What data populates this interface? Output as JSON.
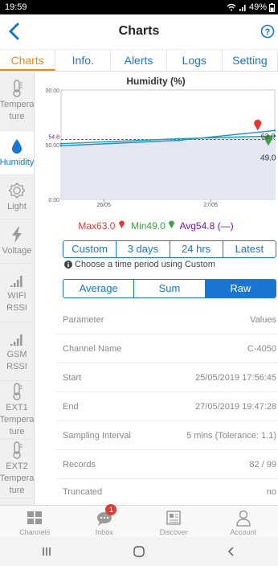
{
  "status": {
    "time": "19:59",
    "battery": "49%"
  },
  "header": {
    "title": "Charts"
  },
  "tabs": [
    "Charts",
    "Info.",
    "Alerts",
    "Logs",
    "Setting"
  ],
  "sidebar": [
    {
      "label": "Tempera ture",
      "icon": "thermometer-icon"
    },
    {
      "label": "Humidity",
      "icon": "humidity-drop-icon"
    },
    {
      "label": "Light",
      "icon": "light-sun-icon"
    },
    {
      "label": "Voltage",
      "icon": "voltage-bolt-icon"
    },
    {
      "label": "WIFI RSSI",
      "icon": "signal-bars-icon"
    },
    {
      "label": "GSM RSSI",
      "icon": "signal-bars-icon"
    },
    {
      "label": "EXT1 Tempera ture",
      "icon": "thermometer-icon"
    },
    {
      "label": "EXT2 Tempera ture",
      "icon": "thermometer-icon"
    },
    {
      "label": "",
      "icon": "thermometer-icon"
    }
  ],
  "chart_data": {
    "type": "line",
    "title": "Humidity (%)",
    "x_ticks": [
      "26/05",
      "27/05"
    ],
    "y_ticks": [
      "00.00",
      "50.00",
      "0.00"
    ],
    "ylim": [
      0,
      100
    ],
    "series": [
      {
        "x": [
          0.0,
          0.55,
          1.0
        ],
        "values": [
          49.0,
          54.0,
          63.0
        ]
      },
      {
        "x": [
          0.0,
          0.55,
          1.0
        ],
        "values": [
          51.0,
          55.5,
          58.0
        ]
      }
    ],
    "avg_line": 54.8,
    "avg_label": "54.8",
    "marker_max_label": "63.0",
    "marker_min_label": "49.0",
    "legend": {
      "max": "Max63.0",
      "min": "Min49.0",
      "avg": "Avg54.8 (—)"
    }
  },
  "range_buttons": [
    "Custom",
    "3 days",
    "24 hrs",
    "Latest"
  ],
  "hint": "Choose a time period using Custom",
  "mode_buttons": [
    "Average",
    "Sum",
    "Raw"
  ],
  "table": {
    "header": {
      "param": "Parameter",
      "value": "Values"
    },
    "rows": [
      {
        "param": "Channel Name",
        "value": "C-4050"
      },
      {
        "param": "Start",
        "value": "25/05/2019 17:56:45"
      },
      {
        "param": "End",
        "value": "27/05/2019 19:47:28"
      },
      {
        "param": "Sampling Interval",
        "value": "5 mins (Tolerance: 1.1)"
      },
      {
        "param": "Records",
        "value": "82 / 99"
      },
      {
        "param": "Truncated",
        "value": "no"
      }
    ]
  },
  "bottom_nav": [
    {
      "label": "Channels",
      "icon": "channels-grid-icon"
    },
    {
      "label": "Inbox",
      "icon": "inbox-chat-icon",
      "badge": "1"
    },
    {
      "label": "Discover",
      "icon": "discover-news-icon"
    },
    {
      "label": "Account",
      "icon": "account-person-icon"
    }
  ],
  "colors": {
    "accent": "#1976d2",
    "active_tab": "#f08a00",
    "max": "#e53935",
    "min": "#43a047"
  }
}
